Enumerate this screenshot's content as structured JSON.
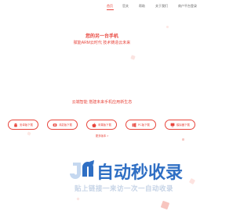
{
  "nav": {
    "items": [
      {
        "label": "首页",
        "active": true
      },
      {
        "label": "官关",
        "active": false
      },
      {
        "label": "帮助",
        "active": false
      },
      {
        "label": "关于我们",
        "active": false
      },
      {
        "label": "商户平台登录",
        "active": false
      }
    ]
  },
  "hero": {
    "title": "您的另一台手机",
    "subtitle": "赋能ARM云时代 技术铸造云未来"
  },
  "slogan": "云端智能 搭建未来手机应用新生态",
  "downloads": [
    {
      "label": "安卓版下载",
      "icon": "android-icon"
    },
    {
      "label": "鸿蒙版下载",
      "icon": "harmony-icon"
    },
    {
      "label": "苹果版下载",
      "icon": "apple-icon"
    },
    {
      "label": "PC版下载",
      "icon": "windows-icon"
    },
    {
      "label": "模拟器下载",
      "icon": "emulator-icon"
    }
  ],
  "more_link": "更多版本 >",
  "watermark": {
    "logo_text": "自动秒收录",
    "tagline": "贴上链接一来访一次一自动收录"
  },
  "colors": {
    "accent": "#e8453c",
    "watermark_blue": "#2f6fc4",
    "watermark_light": "#c5d3e6"
  }
}
